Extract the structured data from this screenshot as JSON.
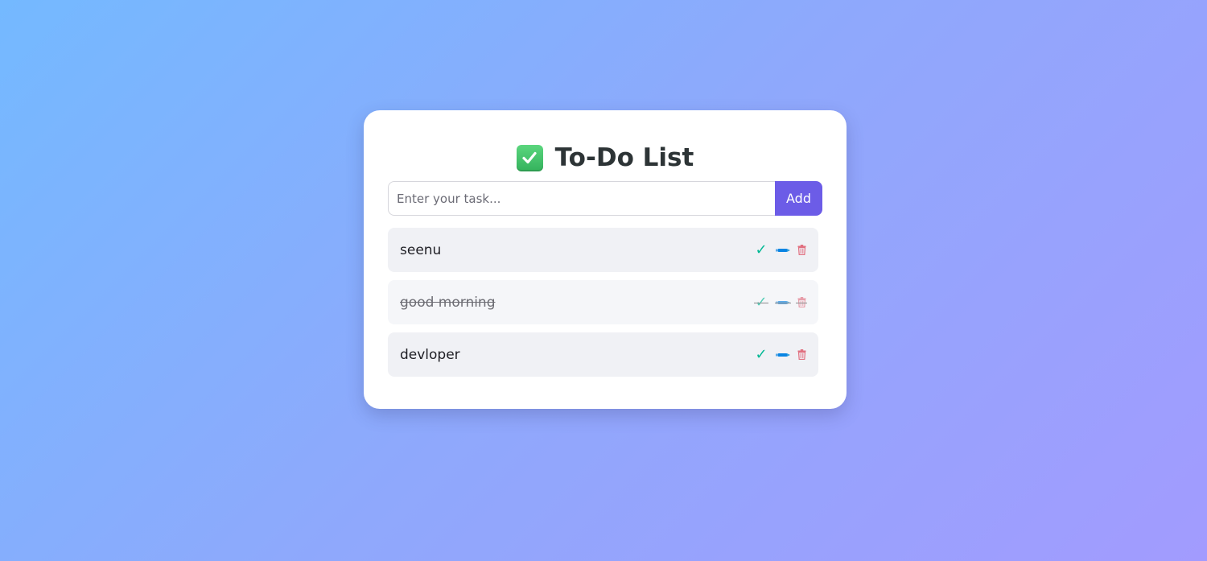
{
  "app": {
    "title": "To-Do List",
    "title_icon": "checkmark-box-icon"
  },
  "input": {
    "placeholder": "Enter your task...",
    "value": ""
  },
  "add_button": {
    "label": "Add"
  },
  "tasks": [
    {
      "text": "seenu",
      "completed": false
    },
    {
      "text": "good morning",
      "completed": true
    },
    {
      "text": "devloper",
      "completed": false
    }
  ],
  "actions": {
    "complete": {
      "label": "✓",
      "icon": "check-icon",
      "color": "#00b894"
    },
    "edit": {
      "icon": "pen-icon",
      "color": "#0984e3"
    },
    "delete": {
      "icon": "trash-icon",
      "color": "#e17080"
    }
  },
  "colors": {
    "accent": "#6c5ce7",
    "gradient_start": "#74b9ff",
    "gradient_end": "#a29bfe"
  }
}
